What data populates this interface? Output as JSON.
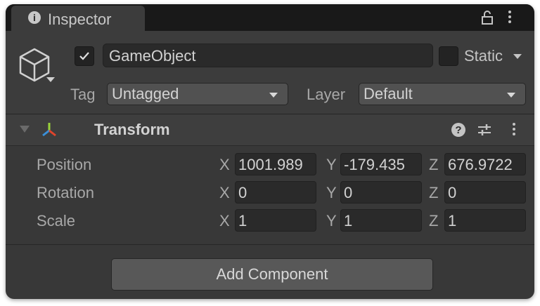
{
  "tab": {
    "title": "Inspector"
  },
  "gameobject": {
    "active": true,
    "name": "GameObject",
    "static_label": "Static",
    "static": false,
    "tag_label": "Tag",
    "tag_value": "Untagged",
    "layer_label": "Layer",
    "layer_value": "Default"
  },
  "transform": {
    "title": "Transform",
    "rows": [
      {
        "label": "Position",
        "x": "1001.989",
        "y": "-179.435",
        "z": "676.9722"
      },
      {
        "label": "Rotation",
        "x": "0",
        "y": "0",
        "z": "0"
      },
      {
        "label": "Scale",
        "x": "1",
        "y": "1",
        "z": "1"
      }
    ],
    "axes": {
      "x": "X",
      "y": "Y",
      "z": "Z"
    }
  },
  "add_component": "Add Component",
  "colors": {
    "background": "#383838",
    "field": "#2a2a2a",
    "dropdown": "#515151",
    "text": "#c4c4c4"
  }
}
